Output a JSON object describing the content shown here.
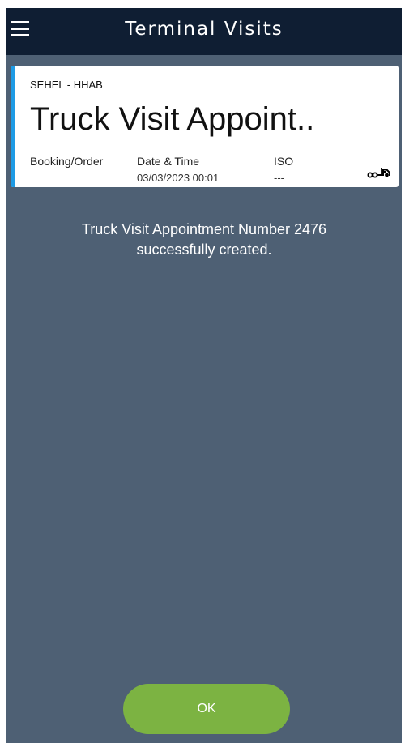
{
  "header": {
    "title": "Terminal Visits"
  },
  "card": {
    "subtitle": "SEHEL - HHAB",
    "title": "Truck Visit Appoint..",
    "columns": [
      {
        "label": "Booking/Order",
        "value": ""
      },
      {
        "label": "Date & Time",
        "value": "03/03/2023 00:01"
      },
      {
        "label": "ISO",
        "value": "---"
      }
    ],
    "accent_color": "#1e9be5",
    "icon": "truck-icon"
  },
  "message": {
    "line1": "Truck Visit Appointment Number 2476",
    "line2": "successfully created."
  },
  "footer": {
    "ok_label": "OK",
    "ok_color": "#7cb342"
  },
  "colors": {
    "appbar": "#0f1e33",
    "background": "#4e6074"
  },
  "icons": {
    "menu": "hamburger-menu-icon"
  }
}
